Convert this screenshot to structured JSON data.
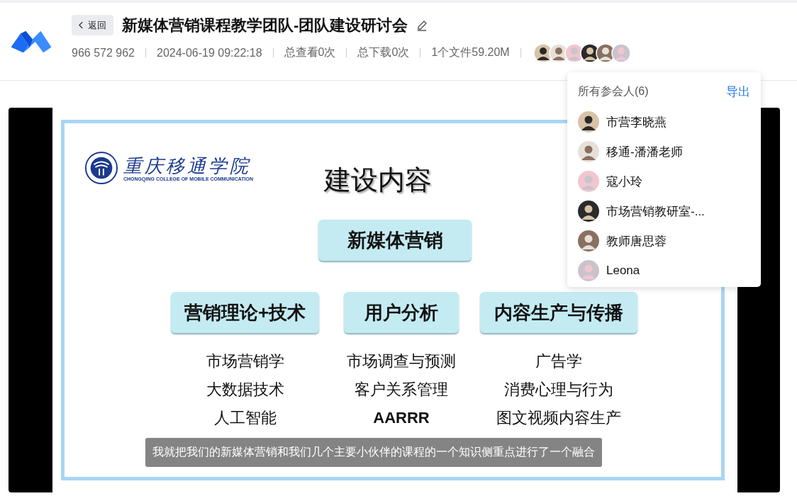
{
  "header": {
    "back_button": "返回",
    "title": "新媒体营销课程教学团队-团队建设研讨会",
    "meta": [
      "966 572 962",
      "2024-06-19 09:22:18",
      "总查看0次",
      "总下载0次",
      "1个文件59.20M"
    ]
  },
  "participants_popup": {
    "title": "所有参会人(6)",
    "export_link": "导出",
    "participants": [
      {
        "name": "市营李晓燕"
      },
      {
        "name": "移通-潘潘老师"
      },
      {
        "name": "寇小玲"
      },
      {
        "name": "市场营销教研室-..."
      },
      {
        "name": "教师唐思蓉"
      },
      {
        "name": "Leona"
      }
    ]
  },
  "slide": {
    "school_name": "重庆移通学院",
    "school_name_en": "CHONGQING COLLEGE OF MOBILE COMMUNICATION",
    "heading": "建设内容",
    "main_topic": "新媒体营销",
    "columns": [
      {
        "title": "营销理论+技术",
        "items": [
          "市场营销学",
          "大数据技术",
          "人工智能"
        ]
      },
      {
        "title": "用户分析",
        "items": [
          "市场调查与预测",
          "客户关系管理",
          "AARRR"
        ]
      },
      {
        "title": "内容生产与传播",
        "items": [
          "广告学",
          "消费心理与行为",
          "图文视频内容生产"
        ]
      }
    ]
  },
  "subtitle": "我就把我们的新媒体营销和我们几个主要小伙伴的课程的一个知识侧重点进行了一个融合"
}
